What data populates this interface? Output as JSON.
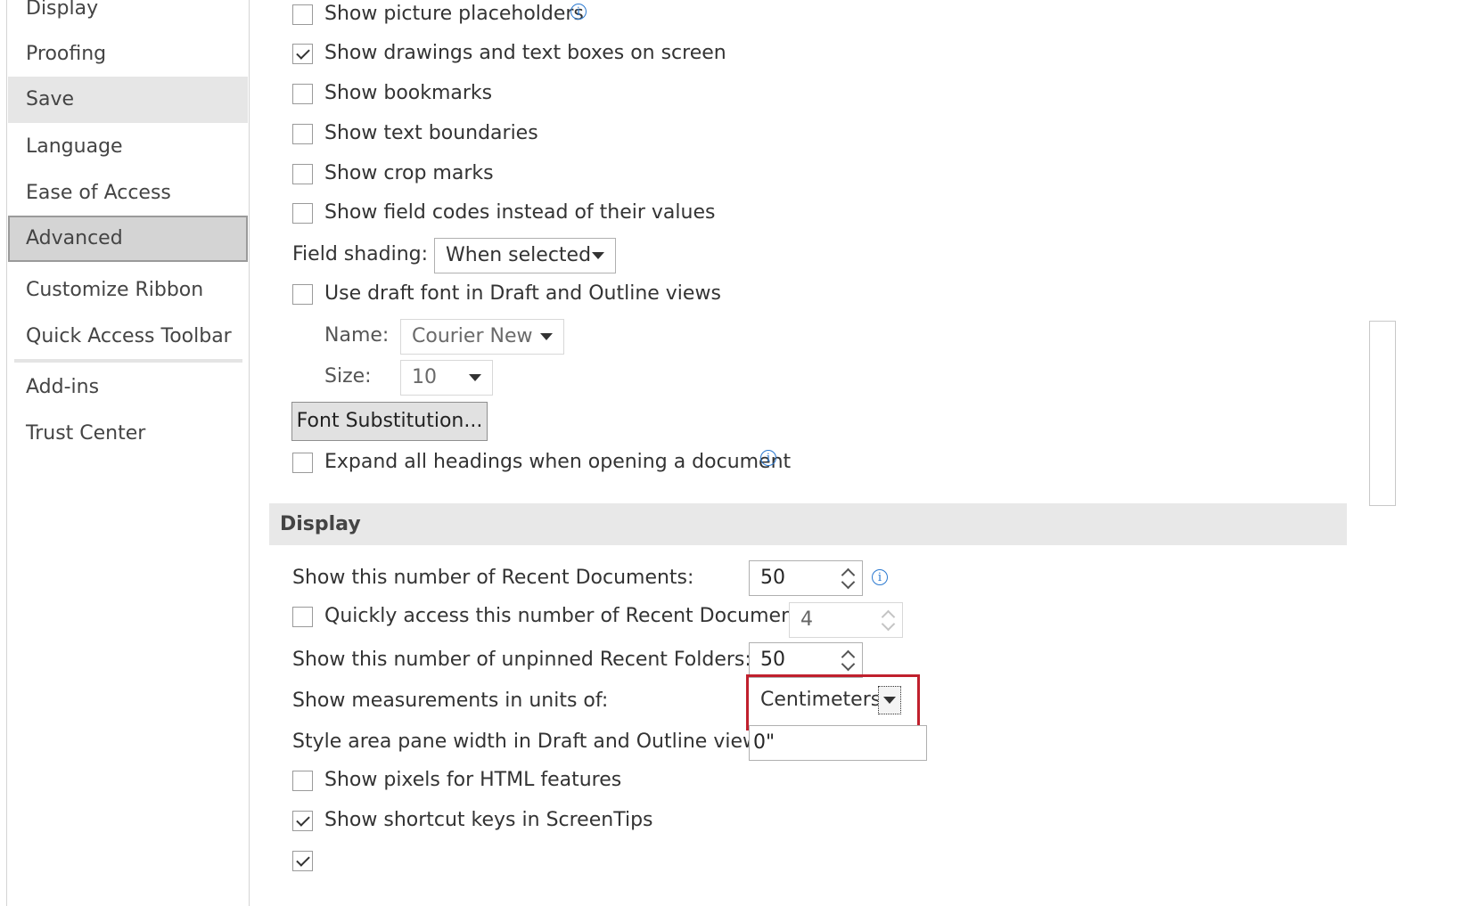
{
  "sidebar": {
    "items": [
      {
        "label": "Display"
      },
      {
        "label": "Proofing"
      },
      {
        "label": "Save"
      },
      {
        "label": "Language"
      },
      {
        "label": "Ease of Access"
      },
      {
        "label": "Advanced"
      },
      {
        "label": "Customize Ribbon"
      },
      {
        "label": "Quick Access Toolbar"
      },
      {
        "label": "Add-ins"
      },
      {
        "label": "Trust Center"
      }
    ]
  },
  "show_content": {
    "picture_placeholders": {
      "label": "Show picture placeholders",
      "checked": false
    },
    "drawings_text_boxes": {
      "label": "Show drawings and text boxes on screen",
      "checked": true
    },
    "bookmarks": {
      "label": "Show bookmarks",
      "checked": false
    },
    "text_boundaries": {
      "label": "Show text boundaries",
      "checked": false
    },
    "crop_marks": {
      "label": "Show crop marks",
      "checked": false
    },
    "field_codes": {
      "label": "Show field codes instead of their values",
      "checked": false
    },
    "field_shading_label": "Field shading:",
    "field_shading_value": "When selected",
    "draft_font": {
      "label": "Use draft font in Draft and Outline views",
      "checked": false
    },
    "name_label": "Name:",
    "name_value": "Courier New",
    "size_label": "Size:",
    "size_value": "10",
    "font_substitution_button": "Font Substitution...",
    "expand_headings": {
      "label": "Expand all headings when opening a document",
      "checked": false
    }
  },
  "display": {
    "section_title": "Display",
    "recent_docs_label": "Show this number of Recent Documents:",
    "recent_docs_value": "50",
    "quick_access": {
      "label": "Quickly access this number of Recent Documents:",
      "checked": false
    },
    "quick_access_value": "4",
    "recent_folders_label": "Show this number of unpinned Recent Folders:",
    "recent_folders_value": "50",
    "measurements_label": "Show measurements in units of:",
    "measurements_value": "Centimeters",
    "style_area_label": "Style area pane width in Draft and Outline views:",
    "style_area_value": "0\"",
    "pixels_html": {
      "label": "Show pixels for HTML features",
      "checked": false
    },
    "shortcut_keys": {
      "label": "Show shortcut keys in ScreenTips",
      "checked": true
    }
  },
  "colors": {
    "highlight": "#c0202d",
    "info": "#2b79d0"
  }
}
